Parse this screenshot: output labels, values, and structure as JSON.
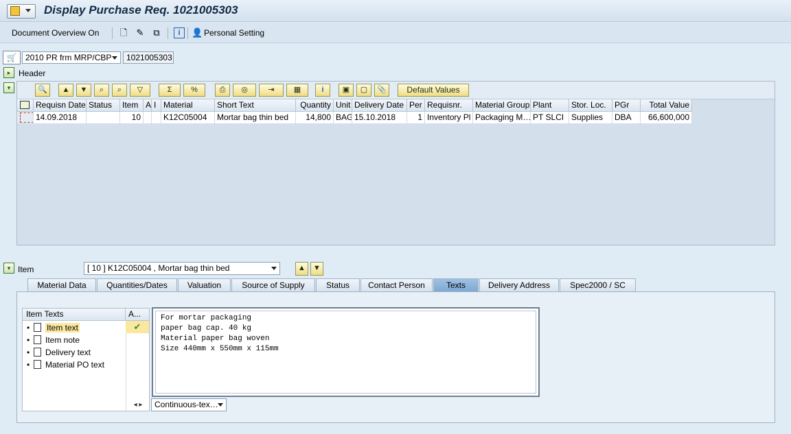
{
  "window": {
    "title": "Display Purchase Req. 1021005303"
  },
  "toolbar": {
    "doc_overview": "Document Overview On",
    "personal_setting": "Personal Setting"
  },
  "header_area": {
    "doc_type": "2010 PR frm MRP/CBP",
    "pr_number": "1021005303",
    "header_label": "Header"
  },
  "grid": {
    "default_values": "Default Values",
    "columns": [
      "Requisn Date",
      "Status",
      "Item",
      "A",
      "I",
      "Material",
      "Short Text",
      "Quantity",
      "Unit",
      "Delivery Date",
      "Per",
      "Requisnr.",
      "Material Group",
      "Plant",
      "Stor. Loc.",
      "PGr",
      "Total Value"
    ],
    "rows": [
      [
        "14.09.2018",
        "",
        "10",
        "",
        "",
        "K12C05004",
        "Mortar bag thin bed",
        "14,800",
        "BAG",
        "15.10.2018",
        "1",
        "Inventory Pl",
        "Packaging M…",
        "PT SLCI",
        "Supplies",
        "DBA",
        "66,600,000"
      ]
    ]
  },
  "item_section": {
    "label": "Item",
    "selector": "[ 10 ] K12C05004 , Mortar bag thin bed"
  },
  "tabs": [
    "Material Data",
    "Quantities/Dates",
    "Valuation",
    "Source of Supply",
    "Status",
    "Contact Person",
    "Texts",
    "Delivery Address",
    "Spec2000 / SC"
  ],
  "active_tab": "Texts",
  "texts": {
    "header": "Item Texts",
    "header2": "A...",
    "items": [
      "Item text",
      "Item note",
      "Delivery text",
      "Material PO text"
    ],
    "editor_lines": [
      "For mortar packaging",
      "paper bag cap. 40 kg",
      "Material paper bag woven",
      "Size 440mm x 550mm x 115mm"
    ],
    "mode": "Continuous-tex…"
  },
  "colors": {
    "background": "#dfebf5",
    "active_tab": "#8db4dc",
    "accent_button": "#f0dc84"
  }
}
